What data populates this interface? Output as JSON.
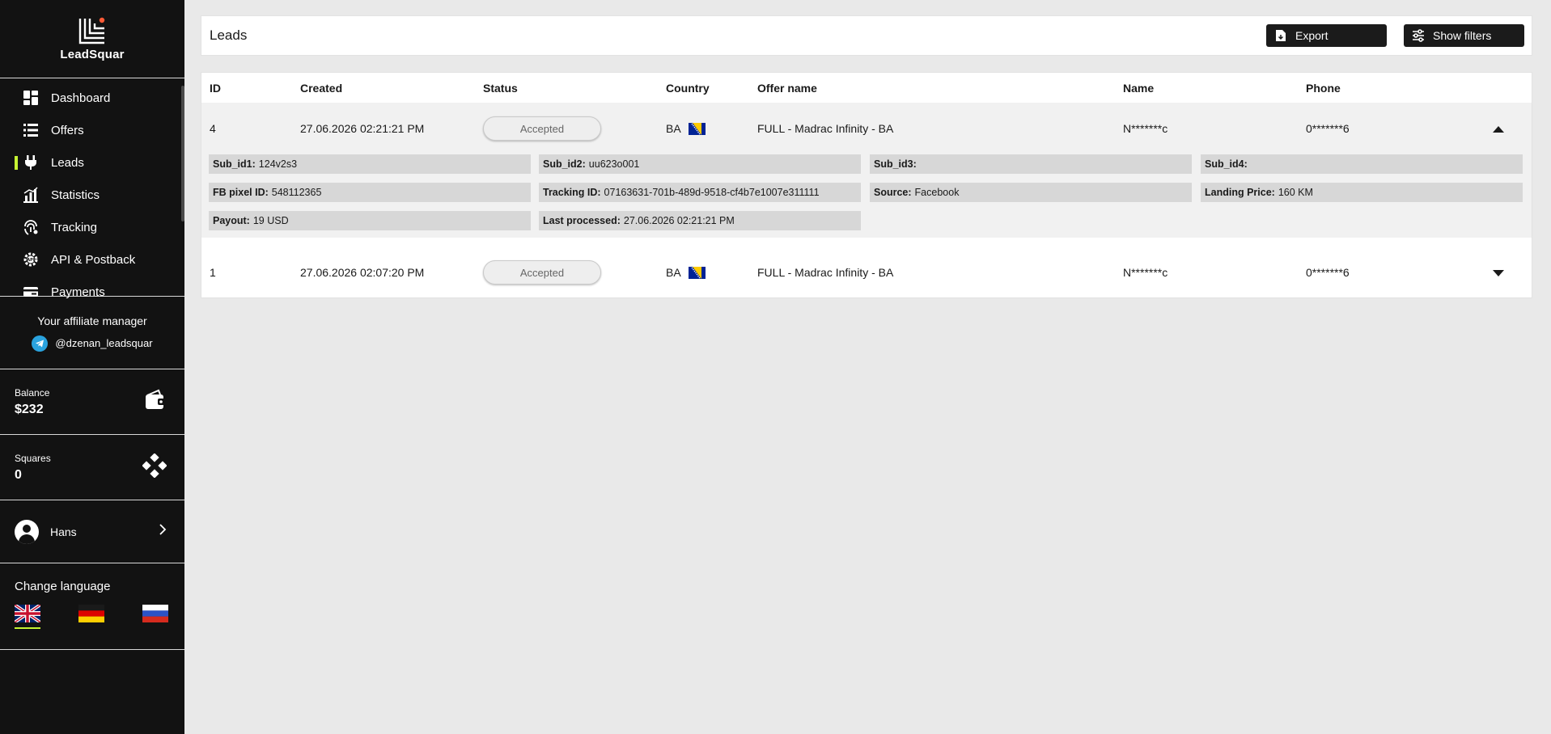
{
  "brand": {
    "name": "LeadSquar"
  },
  "nav": [
    {
      "label": "Dashboard",
      "icon": "dashboard-icon",
      "active": false
    },
    {
      "label": "Offers",
      "icon": "list-icon",
      "active": false
    },
    {
      "label": "Leads",
      "icon": "plug-icon",
      "active": true
    },
    {
      "label": "Statistics",
      "icon": "bar-chart-icon",
      "active": false
    },
    {
      "label": "Tracking",
      "icon": "fingerprint-icon",
      "active": false
    },
    {
      "label": "API & Postback",
      "icon": "api-gear-icon",
      "active": false
    },
    {
      "label": "Payments",
      "icon": "credit-card-icon",
      "active": false
    }
  ],
  "manager": {
    "title": "Your affiliate manager",
    "handle": "@dzenan_leadsquar"
  },
  "balance": {
    "label": "Balance",
    "value": "$232"
  },
  "squares": {
    "label": "Squares",
    "value": "0"
  },
  "user": {
    "name": "Hans"
  },
  "language": {
    "title": "Change language",
    "options": [
      "English",
      "German",
      "Russian"
    ],
    "selected": "English"
  },
  "page": {
    "title": "Leads"
  },
  "toolbar": {
    "export_label": "Export",
    "filters_label": "Show filters"
  },
  "table": {
    "columns": [
      "ID",
      "Created",
      "Status",
      "Country",
      "Offer name",
      "Name",
      "Phone"
    ],
    "rows": [
      {
        "id": "4",
        "created": "27.06.2026 02:21:21 PM",
        "status": "Accepted",
        "country": "BA",
        "offer": "FULL - Madrac Infinity - BA",
        "name": "N*******c",
        "phone": "0*******6",
        "expanded": true,
        "details": {
          "sub_id1": {
            "label": "Sub_id1:",
            "value": "124v2s3"
          },
          "sub_id2": {
            "label": "Sub_id2:",
            "value": "uu623o001"
          },
          "sub_id3": {
            "label": "Sub_id3:",
            "value": ""
          },
          "sub_id4": {
            "label": "Sub_id4:",
            "value": ""
          },
          "fb_pixel": {
            "label": "FB pixel ID:",
            "value": "548112365"
          },
          "tracking": {
            "label": "Tracking ID:",
            "value": "07163631-701b-489d-9518-cf4b7e1007e311111"
          },
          "source": {
            "label": "Source:",
            "value": "Facebook"
          },
          "landing_price": {
            "label": "Landing Price:",
            "value": "160 KM"
          },
          "payout": {
            "label": "Payout:",
            "value": "19 USD"
          },
          "last_processed": {
            "label": "Last processed:",
            "value": "27.06.2026 02:21:21 PM"
          }
        }
      },
      {
        "id": "1",
        "created": "27.06.2026 02:07:20 PM",
        "status": "Accepted",
        "country": "BA",
        "offer": "FULL - Madrac Infinity - BA",
        "name": "N*******c",
        "phone": "0*******6",
        "expanded": false
      }
    ]
  },
  "colors": {
    "sidebar_bg": "#121212",
    "accent": "#c6f432",
    "button_bg": "#1b1b1b",
    "page_bg": "#e9e9e9"
  }
}
